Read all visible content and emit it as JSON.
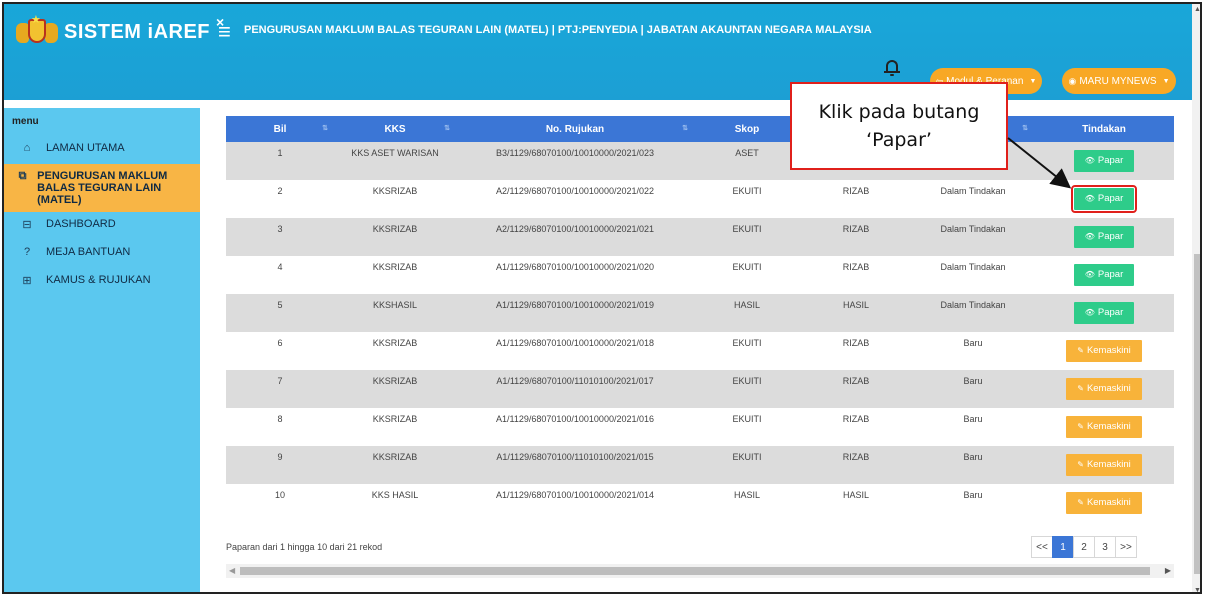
{
  "header": {
    "brand_name": "SISTEM iAREF",
    "hamburger": "≡",
    "close": "×",
    "title": "PENGURUSAN MAKLUM BALAS TEGURAN LAIN (MATEL) | PTJ:PENYEDIA | JABATAN AKAUNTAN NEGARA MALAYSIA",
    "modul_label": "Modul & Peranan",
    "modul_icon": "⇦",
    "user_label": "MARU MYNEWS",
    "user_icon": "◉"
  },
  "sidebar": {
    "heading": "menu",
    "items": [
      {
        "label": "LAMAN UTAMA",
        "icon": "⌂"
      },
      {
        "label": "PENGURUSAN MAKLUM BALAS TEGURAN LAIN (MATEL)",
        "icon": "⧉"
      },
      {
        "label": "DASHBOARD",
        "icon": "⊟"
      },
      {
        "label": "MEJA BANTUAN",
        "icon": "?"
      },
      {
        "label": "KAMUS & RUJUKAN",
        "icon": "⊞"
      }
    ]
  },
  "table": {
    "columns": [
      "Bil",
      "KKS",
      "No. Rujukan",
      "Skop",
      "",
      "",
      "Tindakan"
    ],
    "rows": [
      {
        "bil": "1",
        "kks": "KKS ASET WARISAN",
        "rujukan": "B3/1129/68070100/10010000/2021/023",
        "skop": "ASET",
        "kategori": "",
        "status": "",
        "action": "Papar",
        "type": "papar"
      },
      {
        "bil": "2",
        "kks": "KKSRIZAB",
        "rujukan": "A2/1129/68070100/10010000/2021/022",
        "skop": "EKUITI",
        "kategori": "RIZAB",
        "status": "Dalam Tindakan",
        "action": "Papar",
        "type": "papar"
      },
      {
        "bil": "3",
        "kks": "KKSRIZAB",
        "rujukan": "A2/1129/68070100/10010000/2021/021",
        "skop": "EKUITI",
        "kategori": "RIZAB",
        "status": "Dalam Tindakan",
        "action": "Papar",
        "type": "papar"
      },
      {
        "bil": "4",
        "kks": "KKSRIZAB",
        "rujukan": "A1/1129/68070100/10010000/2021/020",
        "skop": "EKUITI",
        "kategori": "RIZAB",
        "status": "Dalam Tindakan",
        "action": "Papar",
        "type": "papar"
      },
      {
        "bil": "5",
        "kks": "KKSHASIL",
        "rujukan": "A1/1129/68070100/10010000/2021/019",
        "skop": "HASIL",
        "kategori": "HASIL",
        "status": "Dalam Tindakan",
        "action": "Papar",
        "type": "papar"
      },
      {
        "bil": "6",
        "kks": "KKSRIZAB",
        "rujukan": "A1/1129/68070100/10010000/2021/018",
        "skop": "EKUITI",
        "kategori": "RIZAB",
        "status": "Baru",
        "action": "Kemaskini",
        "type": "kemaskini"
      },
      {
        "bil": "7",
        "kks": "KKSRIZAB",
        "rujukan": "A1/1129/68070100/11010100/2021/017",
        "skop": "EKUITI",
        "kategori": "RIZAB",
        "status": "Baru",
        "action": "Kemaskini",
        "type": "kemaskini"
      },
      {
        "bil": "8",
        "kks": "KKSRIZAB",
        "rujukan": "A1/1129/68070100/10010000/2021/016",
        "skop": "EKUITI",
        "kategori": "RIZAB",
        "status": "Baru",
        "action": "Kemaskini",
        "type": "kemaskini"
      },
      {
        "bil": "9",
        "kks": "KKSRIZAB",
        "rujukan": "A1/1129/68070100/11010100/2021/015",
        "skop": "EKUITI",
        "kategori": "RIZAB",
        "status": "Baru",
        "action": "Kemaskini",
        "type": "kemaskini"
      },
      {
        "bil": "10",
        "kks": "KKS HASIL",
        "rujukan": "A1/1129/68070100/10010000/2021/014",
        "skop": "HASIL",
        "kategori": "HASIL",
        "status": "Baru",
        "action": "Kemaskini",
        "type": "kemaskini"
      }
    ],
    "papar_icon": "👁",
    "kemaskini_icon": "✎",
    "highlighted_row": 1
  },
  "footer": {
    "info": "Paparan dari 1 hingga 10 dari 21 rekod",
    "pages": [
      "<<",
      "1",
      "2",
      "3",
      ">>"
    ],
    "active_page": "1"
  },
  "callout": {
    "line1": "Klik pada butang",
    "line2": "‘Papar’"
  },
  "colors": {
    "header_bg": "#1ca4d7",
    "sidebar_bg": "#5bc8ef",
    "active_menu": "#f8b545",
    "table_header": "#3b76d6",
    "papar_btn": "#2ecc8a",
    "kemaskini_btn": "#f8b33a",
    "annotation_red": "#e0201b"
  }
}
